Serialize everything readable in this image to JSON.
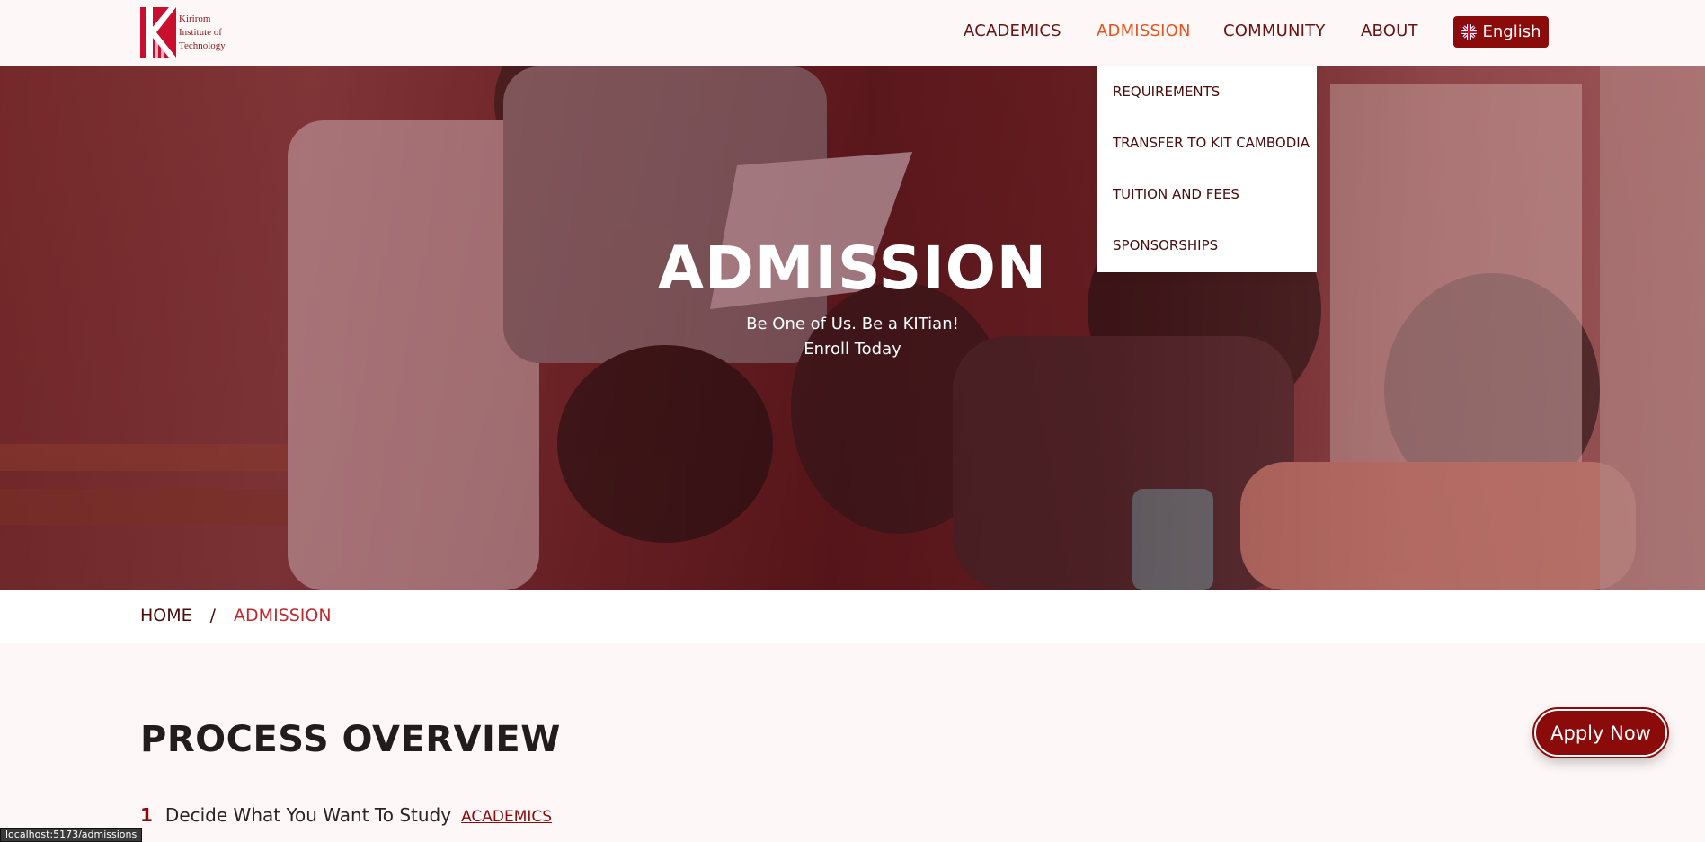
{
  "brand": {
    "logo_lines": [
      "Kirirom",
      "Institute of",
      "Technology"
    ],
    "primary_color": "#8b0a0a",
    "accent_color": "#e6541d"
  },
  "nav": {
    "items": [
      {
        "label": "ACADEMICS",
        "active": false
      },
      {
        "label": "ADMISSION",
        "active": true
      },
      {
        "label": "COMMUNITY",
        "active": false
      },
      {
        "label": "ABOUT",
        "active": false
      }
    ],
    "language": {
      "label": "English",
      "icon": "uk-flag-icon"
    }
  },
  "dropdown": {
    "items": [
      "REQUIREMENTS",
      "TRANSFER TO KIT CAMBODIA",
      "TUITION AND FEES",
      "SPONSORSHIPS"
    ]
  },
  "hero": {
    "title": "ADMISSION",
    "subtitle_line1": "Be One of Us. Be a KITian!",
    "subtitle_line2": "Enroll Today"
  },
  "breadcrumb": {
    "home": "HOME",
    "separator": "/",
    "current": "ADMISSION"
  },
  "process": {
    "title": "PROCESS OVERVIEW",
    "steps": [
      {
        "number": "1",
        "text": "Decide What You Want To Study",
        "link": "ACADEMICS"
      }
    ]
  },
  "apply_button": "Apply Now",
  "status_bar": "localhost:5173/admissions"
}
